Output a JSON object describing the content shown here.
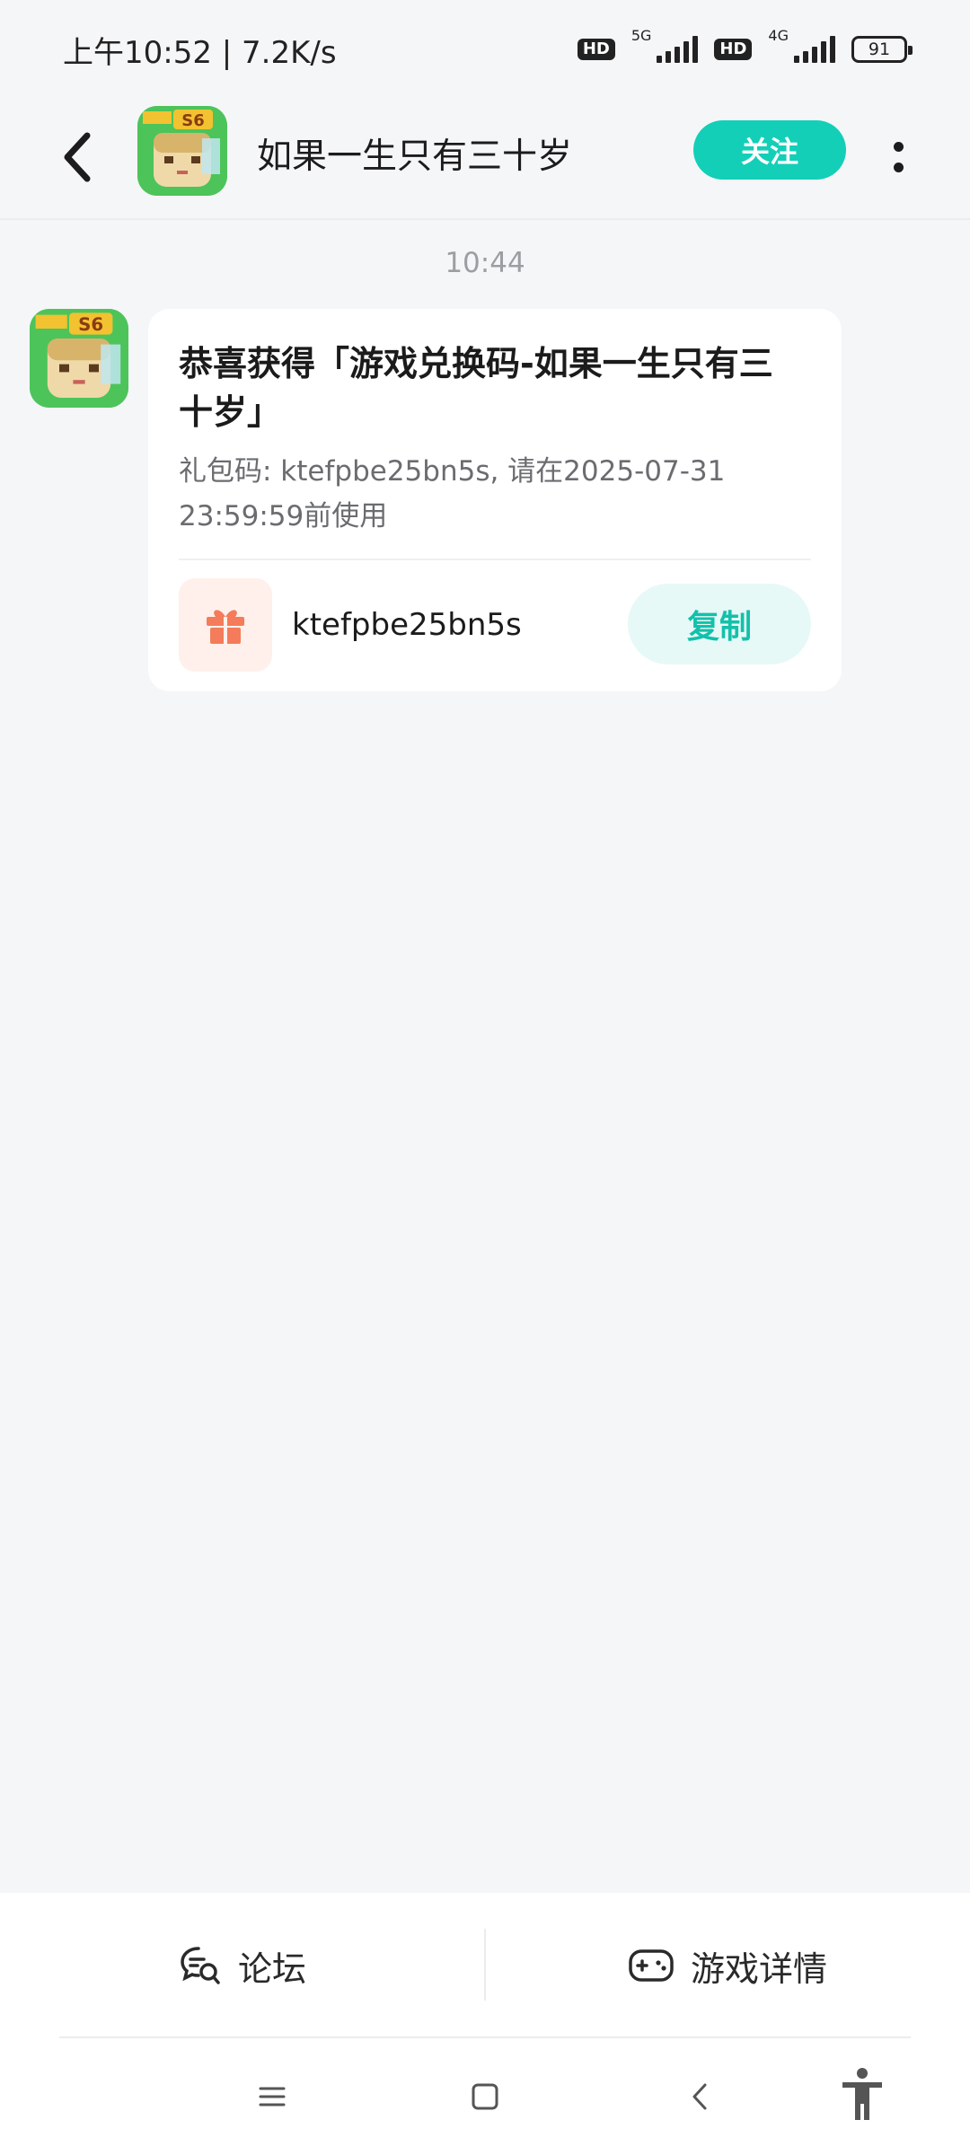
{
  "status_bar": {
    "time_speed": "上午10:52 | 7.2K/s",
    "hd1": "HD",
    "net1": "5G",
    "hd2": "HD",
    "net2": "4G",
    "battery": "91"
  },
  "header": {
    "back_icon": "chevron-left-icon",
    "title": "如果一生只有三十岁",
    "follow_label": "关注",
    "more_icon": "more-vertical-icon"
  },
  "chat": {
    "timestamp": "10:44",
    "message": {
      "title": "恭喜获得「游戏兑换码-如果一生只有三十岁」",
      "description": "礼包码: ktefpbe25bn5s, 请在2025-07-31 23:59:59前使用",
      "code": "ktefpbe25bn5s",
      "copy_label": "复制",
      "gift_icon": "gift-icon"
    }
  },
  "bottom_tabs": [
    {
      "label": "论坛",
      "icon": "forum-icon"
    },
    {
      "label": "游戏详情",
      "icon": "gamepad-icon"
    }
  ],
  "nav_bar": {
    "items": [
      "menu-icon",
      "home-icon",
      "back-icon",
      "accessibility-icon"
    ]
  },
  "colors": {
    "accent": "#13cfb8",
    "background": "#f5f6f8",
    "gift": "#f47c5a"
  }
}
